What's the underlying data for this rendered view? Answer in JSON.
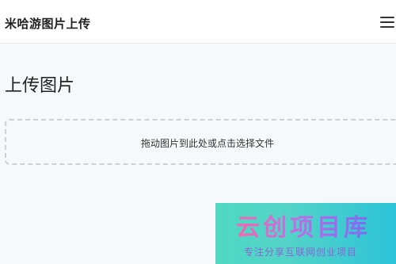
{
  "header": {
    "title": "米哈游图片上传",
    "menu_icon": "hamburger-menu-icon"
  },
  "main": {
    "page_title": "上传图片",
    "dropzone_text": "拖动图片到此处或点击选择文件"
  },
  "watermark": {
    "logo_text": "云创项目库",
    "slogan": "专注分享互联网创业项目"
  },
  "colors": {
    "header_bg": "#ffffff",
    "page_bg": "#f6f8fb",
    "dropzone_border": "#cdd1d7",
    "watermark_bg": "#4fd8c4",
    "watermark_logo": "#b86ee8"
  }
}
